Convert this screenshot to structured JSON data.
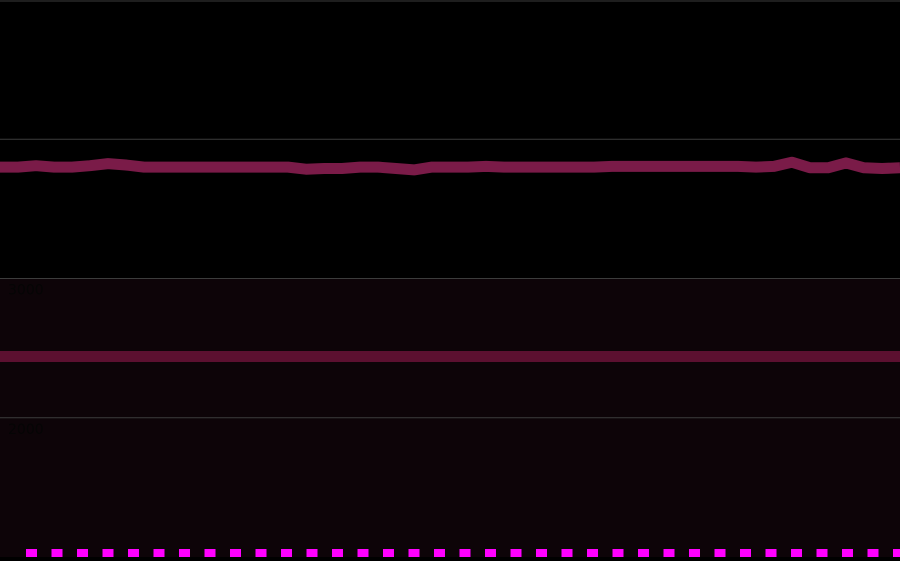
{
  "chart_data": {
    "type": "area",
    "title": "",
    "xlabel": "",
    "ylabel": "",
    "y_tick_labels": [
      "3000",
      "2000"
    ],
    "y_ticks": [
      3000,
      2000
    ],
    "ylim": [
      1000,
      5000
    ],
    "grid": true,
    "legend": "none",
    "series": [
      {
        "x": [
          0,
          1,
          2,
          3,
          4,
          5,
          6,
          7,
          8,
          9,
          10,
          11,
          12,
          13,
          14,
          15,
          16,
          17,
          18,
          19,
          20,
          21,
          22,
          23,
          24,
          25,
          26,
          27,
          28,
          29,
          30,
          31,
          32,
          33,
          34,
          35,
          36,
          37,
          38,
          39,
          40,
          41,
          42,
          43,
          44,
          45,
          46,
          47,
          48,
          49,
          50
        ],
        "values": [
          3800,
          3800,
          3810,
          3800,
          3800,
          3810,
          3825,
          3815,
          3800,
          3800,
          3800,
          3800,
          3800,
          3800,
          3800,
          3800,
          3800,
          3785,
          3790,
          3790,
          3800,
          3800,
          3790,
          3780,
          3800,
          3800,
          3800,
          3805,
          3800,
          3800,
          3800,
          3800,
          3800,
          3800,
          3805,
          3805,
          3805,
          3805,
          3805,
          3805,
          3805,
          3805,
          3800,
          3805,
          3835,
          3795,
          3795,
          3830,
          3795,
          3790,
          3795
        ]
      },
      {
        "x": [
          0,
          50
        ],
        "values": [
          2440,
          2440
        ]
      }
    ]
  },
  "colors": {
    "background": "#000000",
    "lower_band_fill": "#0d0408",
    "upper_series_line": "#7a1b48",
    "lower_series_line": "#5c1030",
    "gridline": "#3c3c3c",
    "tick_label": "#050505",
    "bottom_marker": "#ff00ff"
  }
}
